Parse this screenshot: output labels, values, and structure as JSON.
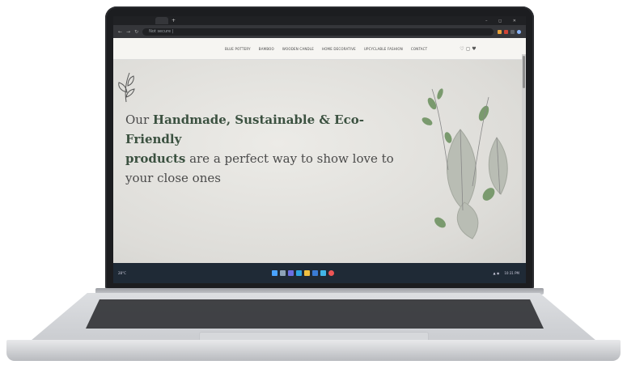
{
  "browser": {
    "tab_title": "",
    "address": "Not secure |",
    "window_controls": "–  ◻  ✕",
    "nav_back": "←",
    "nav_forward": "→",
    "nav_reload": "↻"
  },
  "site": {
    "nav": [
      "BLUE POTTERY",
      "BAMBOO",
      "WOODEN CANDLE",
      "HOME DECORATIVE",
      "UPCYCLABLE FASHION",
      "CONTACT"
    ],
    "nav_icons": "♡ ◻ ♥",
    "hero": {
      "line1_prefix": "Our ",
      "line1_bold": "Handmade, Sustainable & Eco-Friendly",
      "line2_bold": "products",
      "line2_rest": " are a perfect way to show love to",
      "line3": "your close ones"
    }
  },
  "taskbar": {
    "weather": "28°C",
    "time": "10:31 PM"
  },
  "colors": {
    "accent_green": "#3b5140",
    "leaf_green": "#7a9a6e"
  }
}
